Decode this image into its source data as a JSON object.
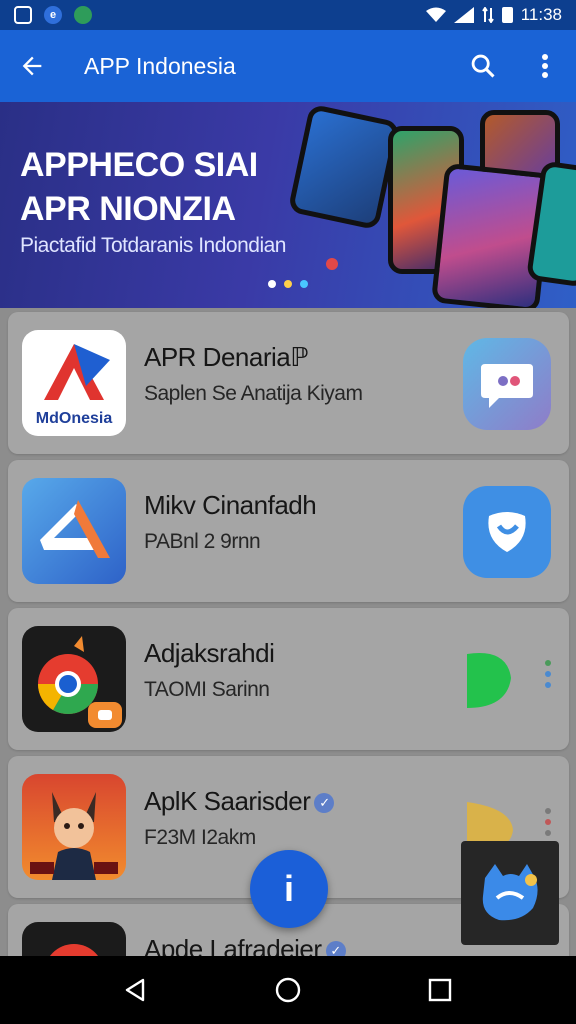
{
  "status_bar": {
    "time": "11:38"
  },
  "app_bar": {
    "title": "APP Indonesia"
  },
  "banner": {
    "line1": "APPHECO SIAI",
    "line2": "APR NIONZIA",
    "subtitle": "Piactafid Totdaranis Indondian"
  },
  "apps": [
    {
      "name": "APR Denariaℙ",
      "subtitle": "Saplen Se Anatija Kiyam",
      "icon_label": "MdOnesia"
    },
    {
      "name": "Mikv Cinanfadh",
      "subtitle": "PABnl 2 9rnn"
    },
    {
      "name": "Adjaksrahdi",
      "subtitle": "TAOMI Sarinn"
    },
    {
      "name": "AplK Saarisder",
      "subtitle": "F23M I2akm"
    },
    {
      "name": "Apde Lafradeier",
      "subtitle": ""
    }
  ],
  "fab": {
    "label": "i"
  },
  "colors": {
    "primary": "#1a63d6",
    "status_bar": "#0d3f8f",
    "list_bg": "#8d8d8d",
    "card_bg": "#a5a5a5"
  }
}
